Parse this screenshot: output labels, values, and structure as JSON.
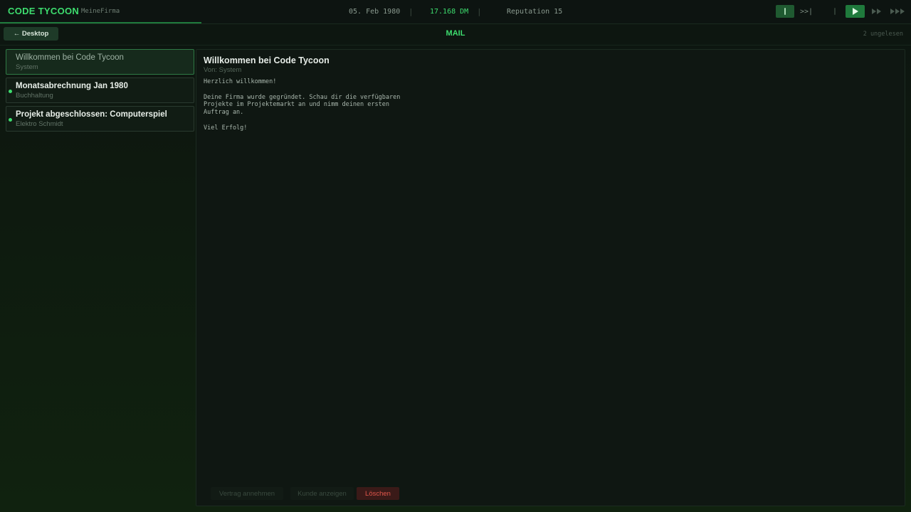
{
  "topbar": {
    "brand": "CODE TYCOON",
    "company": "MeineFirma",
    "date": "05. Feb 1980",
    "money": "17.168 DM",
    "reputation": "Reputation 15",
    "separator": "|",
    "step_label": ">>|"
  },
  "header": {
    "back_label": "← Desktop",
    "title": "MAIL",
    "unread": "2 ungelesen"
  },
  "mails": [
    {
      "subject": "Willkommen bei Code Tycoon",
      "from": "System",
      "unread": false,
      "selected": true
    },
    {
      "subject": "Monatsabrechnung Jan 1980",
      "from": "Buchhaltung",
      "unread": true,
      "selected": false
    },
    {
      "subject": "Projekt abgeschlossen: Computerspiel",
      "from": "Elektro Schmidt",
      "unread": true,
      "selected": false
    }
  ],
  "reader": {
    "subject": "Willkommen bei Code Tycoon",
    "from_label": "Von: System",
    "body": "Herzlich willkommen!\n\nDeine Firma wurde gegründet. Schau dir die verfügbaren\nProjekte im Projektemarkt an und nimm deinen ersten\nAuftrag an.\n\nViel Erfolg!"
  },
  "actions": {
    "accept": "Vertrag annehmen",
    "customer": "Kunde anzeigen",
    "delete": "Löschen"
  },
  "colors": {
    "accent": "#3ddc6e",
    "danger": "#e0564b"
  }
}
